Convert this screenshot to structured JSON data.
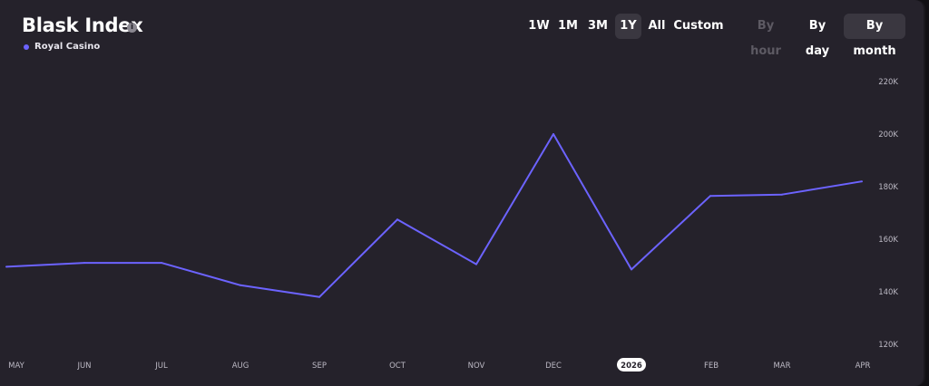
{
  "header": {
    "title": "Blask Index",
    "info_icon": "info-icon"
  },
  "legend": {
    "label": "Royal Casino",
    "color": "#6c63ff"
  },
  "ranges": [
    "1W",
    "1M",
    "3M",
    "1Y",
    "All",
    "Custom"
  ],
  "active_range": "1Y",
  "granularity": [
    "By hour",
    "By day",
    "By month"
  ],
  "active_granularity": "By month",
  "disabled_granularity": "By hour",
  "colors": {
    "background": "#25222b",
    "line": "#6c63ff",
    "axis_text": "#bcb9c4",
    "highlight_tick_bg": "#ffffff"
  },
  "chart_data": {
    "type": "line",
    "title": "Blask Index",
    "x": [
      "MAY",
      "JUN",
      "JUL",
      "AUG",
      "SEP",
      "OCT",
      "NOV",
      "DEC",
      "2026",
      "FEB",
      "MAR",
      "APR"
    ],
    "highlighted_tick": "2026",
    "series": [
      {
        "name": "Royal Casino",
        "values": [
          149500,
          151000,
          151000,
          142500,
          138000,
          167500,
          150500,
          200000,
          148500,
          176500,
          177000,
          182000
        ]
      }
    ],
    "yticks": [
      "120K",
      "140K",
      "160K",
      "180K",
      "200K",
      "220K"
    ],
    "ylim": [
      120000,
      220000
    ],
    "y_axis_side": "right",
    "grid": false
  }
}
